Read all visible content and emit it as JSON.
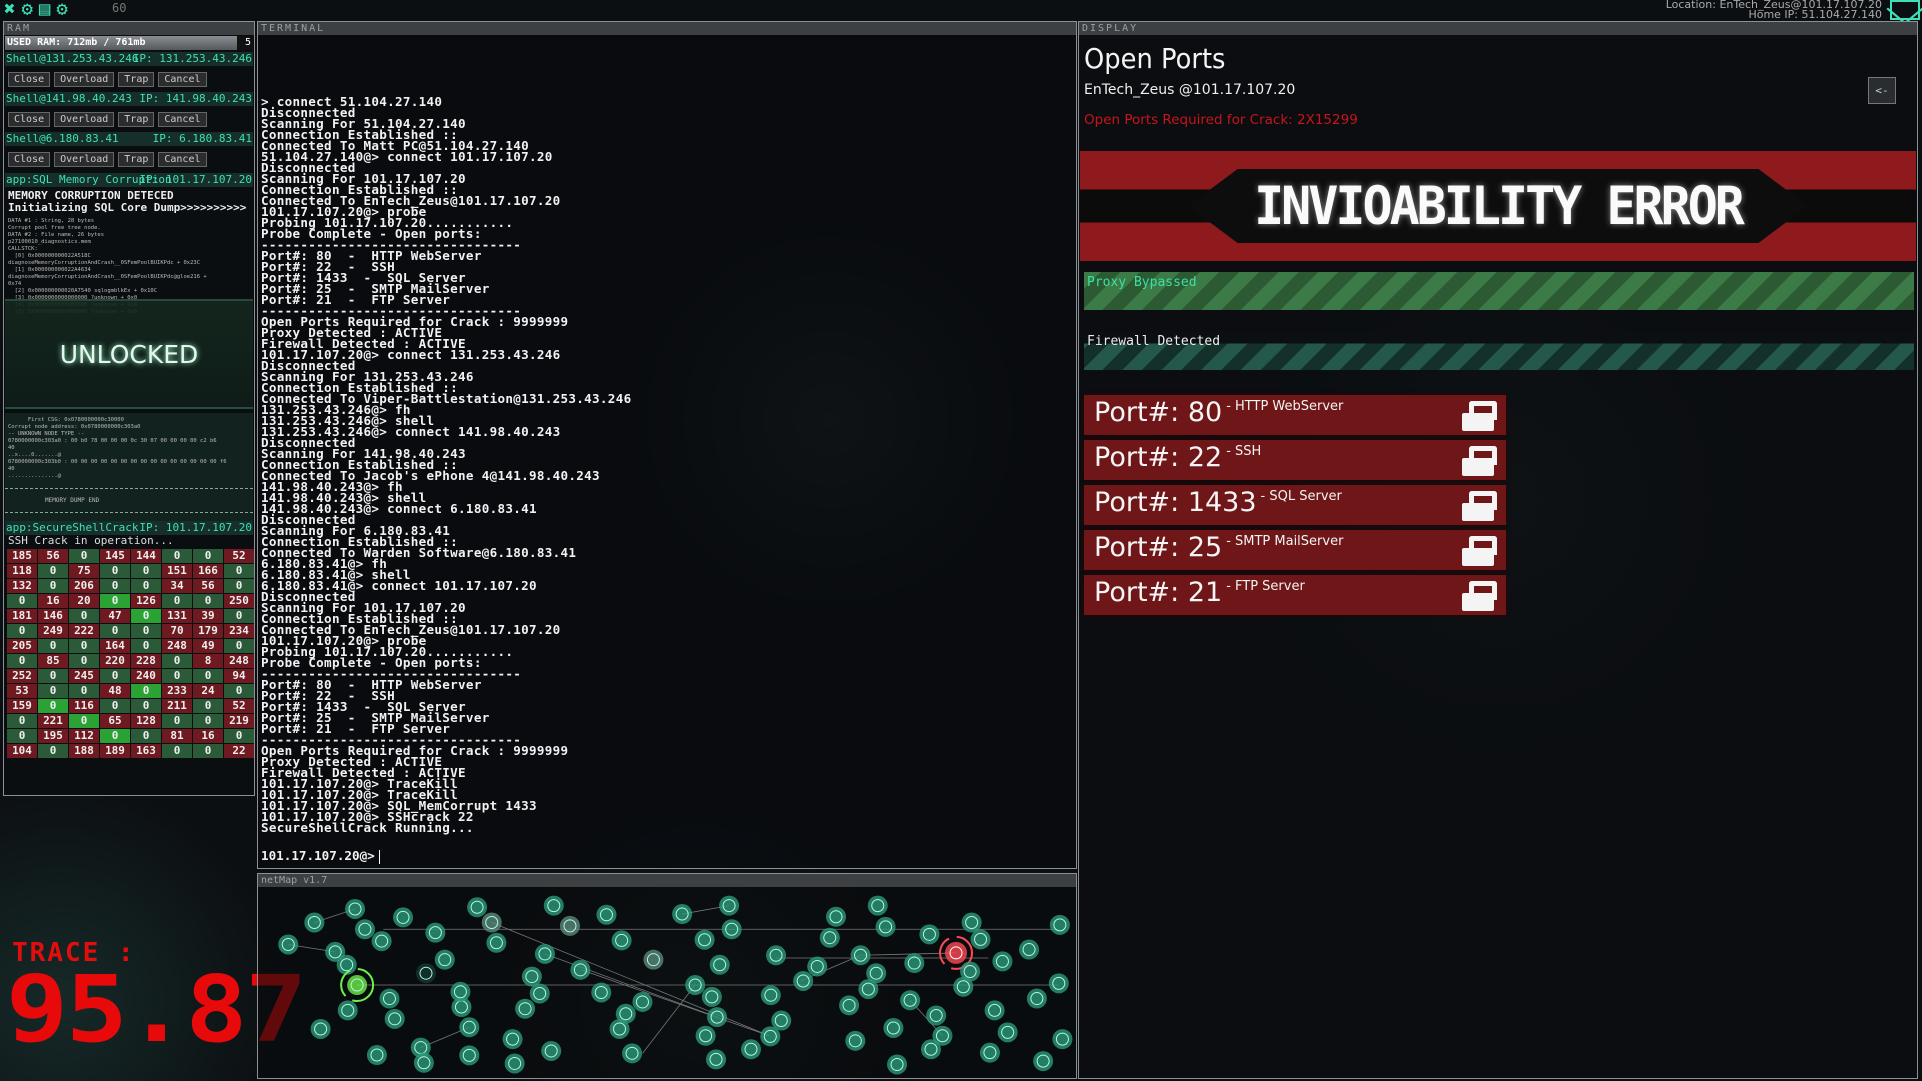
{
  "topbar": {
    "icons": [
      "exit-icon",
      "settings-icon",
      "save-icon",
      "gear-icon"
    ],
    "fps": "60",
    "location": "Location: EnTech_Zeus@101.17.107.20",
    "home_ip": "Home IP: 51.104.27.140",
    "accent": "#3ee0b6"
  },
  "ram": {
    "header": "RAM",
    "used_label": "USED RAM: 712mb / 761mb",
    "used_mb": 712,
    "total_mb": 761,
    "count": "5",
    "shells": [
      {
        "name": "Shell@131.253.43.246",
        "ip": "IP: 131.253.43.246"
      },
      {
        "name": "Shell@141.98.40.243",
        "ip": "IP: 141.98.40.243"
      },
      {
        "name": "Shell@6.180.83.41",
        "ip": "IP: 6.180.83.41"
      }
    ],
    "shell_buttons": [
      "Close",
      "Overload",
      "Trap",
      "Cancel"
    ],
    "sql": {
      "title": "app:SQL Memory Corruption",
      "ip": "IP: 101.17.107.20",
      "line1": "MEMORY CORRUPTION DETECED",
      "line2": "Initializing SQL Core Dump>>>>>>>>>>",
      "dump_top": [
        "DATA #1 : String, 28 bytes",
        "Corrupt pool free tree node.",
        "DATA #2 : File name, 26 bytes",
        "p27100010_diagnostics.mem",
        "CALLSTCK:",
        "  [0] 0x000000000022A518C",
        "diagnoseMemoryCorruptionAndCrash__0SFemPoolBUIKPdc + 0x23C",
        "  [1] 0x000000000022A4634",
        "diagnoseMemoryCorruptionAndCrash__0SFemPoolBUIKPdc@gloe216 +",
        "0x74",
        "  [2] 0x000000000020A7540 sqlogmblkEx + 0x10C",
        "  [3] 0x0000000000000000 ?unknown + 0x0",
        "  [4] 0x0000000000000000 ?unknown + 0x0",
        "  [5] 0x0000000000000000 ?unknown + 0x0"
      ],
      "status": "UNLOCKED",
      "dump_bottom": [
        "      First CSG: 0x0780000000c30000",
        "Corrupt node address: 0x0780000000c303a0",
        "-- UNKNOWN NODE TYPE --",
        "0780000000c303a0 : 00 b0 78 00 00 00 0c 30 07 00 00 00 00 c2 b6",
        "40",
        "..x....0.......@",
        "0780000000c303b0 : 00 00 00 00 00 00 00 00 00 00 00 00 00 00 00 f6",
        "40",
        "...............@"
      ],
      "dump_end": "MEMORY DUMP END"
    },
    "ssh": {
      "title": "app:SecureShellCrack",
      "ip": "IP: 101.17.107.20",
      "status": "SSH Crack in operation...",
      "grid": [
        [
          185,
          56,
          0,
          145,
          144,
          0,
          0,
          52
        ],
        [
          118,
          0,
          75,
          0,
          0,
          151,
          166,
          0
        ],
        [
          132,
          0,
          206,
          0,
          0,
          34,
          56,
          0
        ],
        [
          0,
          16,
          20,
          0,
          126,
          0,
          0,
          250
        ],
        [
          181,
          146,
          0,
          47,
          0,
          131,
          39,
          0
        ],
        [
          0,
          249,
          222,
          0,
          0,
          70,
          179,
          234
        ],
        [
          205,
          0,
          0,
          164,
          0,
          248,
          49,
          0
        ],
        [
          0,
          85,
          0,
          220,
          228,
          0,
          8,
          248
        ],
        [
          252,
          0,
          245,
          0,
          240,
          0,
          0,
          94
        ],
        [
          53,
          0,
          0,
          48,
          0,
          233,
          24,
          0
        ],
        [
          159,
          0,
          116,
          0,
          0,
          211,
          0,
          52
        ],
        [
          0,
          221,
          0,
          65,
          128,
          0,
          0,
          219
        ],
        [
          0,
          195,
          112,
          0,
          0,
          81,
          16,
          0
        ],
        [
          104,
          0,
          188,
          189,
          163,
          0,
          0,
          22
        ]
      ],
      "active_cells": [
        [
          3,
          3
        ],
        [
          4,
          4
        ],
        [
          9,
          4
        ],
        [
          10,
          1
        ],
        [
          11,
          2
        ],
        [
          12,
          3
        ]
      ],
      "colors": {
        "nonzero": "#6e1a20",
        "zero": "#2b5a38",
        "active": "#2aa234"
      }
    }
  },
  "trace": {
    "label": "TRACE :",
    "value": "95.87",
    "color": "#e80a0a"
  },
  "terminal": {
    "header": "TERMINAL",
    "lines": [
      "> connect 51.104.27.140",
      "Disconnected",
      "Scanning For 51.104.27.140",
      "Connection Established ::",
      "Connected To Matt PC@51.104.27.140",
      "51.104.27.140@> connect 101.17.107.20",
      "Disconnected",
      "Scanning For 101.17.107.20",
      "Connection Established ::",
      "Connected To EnTech_Zeus@101.17.107.20",
      "101.17.107.20@> probe",
      "Probing 101.17.107.20...........",
      "Probe Complete - Open ports:",
      "---------------------------------",
      "Port#: 80  -  HTTP WebServer",
      "Port#: 22  -  SSH",
      "Port#: 1433  -  SQL Server",
      "Port#: 25  -  SMTP MailServer",
      "Port#: 21  -  FTP Server",
      "---------------------------------",
      "Open Ports Required for Crack : 9999999",
      "Proxy Detected : ACTIVE",
      "Firewall Detected : ACTIVE",
      "101.17.107.20@> connect 131.253.43.246",
      "Disconnected",
      "Scanning For 131.253.43.246",
      "Connection Established ::",
      "Connected To Viper-Battlestation@131.253.43.246",
      "131.253.43.246@> fh",
      "131.253.43.246@> shell",
      "131.253.43.246@> connect 141.98.40.243",
      "Disconnected",
      "Scanning For 141.98.40.243",
      "Connection Established ::",
      "Connected To Jacob's ePhone 4@141.98.40.243",
      "141.98.40.243@> fh",
      "141.98.40.243@> shell",
      "141.98.40.243@> connect 6.180.83.41",
      "Disconnected",
      "Scanning For 6.180.83.41",
      "Connection Established ::",
      "Connected To Warden Software@6.180.83.41",
      "6.180.83.41@> fh",
      "6.180.83.41@> shell",
      "6.180.83.41@> connect 101.17.107.20",
      "Disconnected",
      "Scanning For 101.17.107.20",
      "Connection Established ::",
      "Connected To EnTech_Zeus@101.17.107.20",
      "101.17.107.20@> probe",
      "Probing 101.17.107.20...........",
      "Probe Complete - Open ports:",
      "---------------------------------",
      "Port#: 80  -  HTTP WebServer",
      "Port#: 22  -  SSH",
      "Port#: 1433  -  SQL Server",
      "Port#: 25  -  SMTP MailServer",
      "Port#: 21  -  FTP Server",
      "---------------------------------",
      "Open Ports Required for Crack : 9999999",
      "Proxy Detected : ACTIVE",
      "Firewall Detected : ACTIVE",
      "101.17.107.20@> TraceKill",
      "101.17.107.20@> TraceKill",
      "101.17.107.20@> SQL_MemCorrupt 1433",
      "101.17.107.20@> SSHcrack 22",
      "SecureShellCrack Running..."
    ],
    "prompt": "101.17.107.20@>"
  },
  "netmap": {
    "header": "netMap v1.7",
    "node_color": "#2a9a7a",
    "player_color": "#6ef04a",
    "target_color": "#ff4a55"
  },
  "display": {
    "header": "DISPLAY",
    "title": "Open Ports",
    "host": "EnTech_Zeus @101.17.107.20",
    "required": "Open Ports Required for Crack: 2X15299",
    "back_label": "<-",
    "error": "INVIOABILITY ERROR",
    "proxy": "Proxy Bypassed",
    "firewall": "Firewall Detected",
    "ports": [
      {
        "label": "Port#: 80",
        "desc": "- HTTP WebServer"
      },
      {
        "label": "Port#: 22",
        "desc": "- SSH"
      },
      {
        "label": "Port#: 1433",
        "desc": "- SQL Server"
      },
      {
        "label": "Port#: 25",
        "desc": "- SMTP MailServer"
      },
      {
        "label": "Port#: 21",
        "desc": "- FTP Server"
      }
    ],
    "error_color": "#8f1a1e"
  }
}
